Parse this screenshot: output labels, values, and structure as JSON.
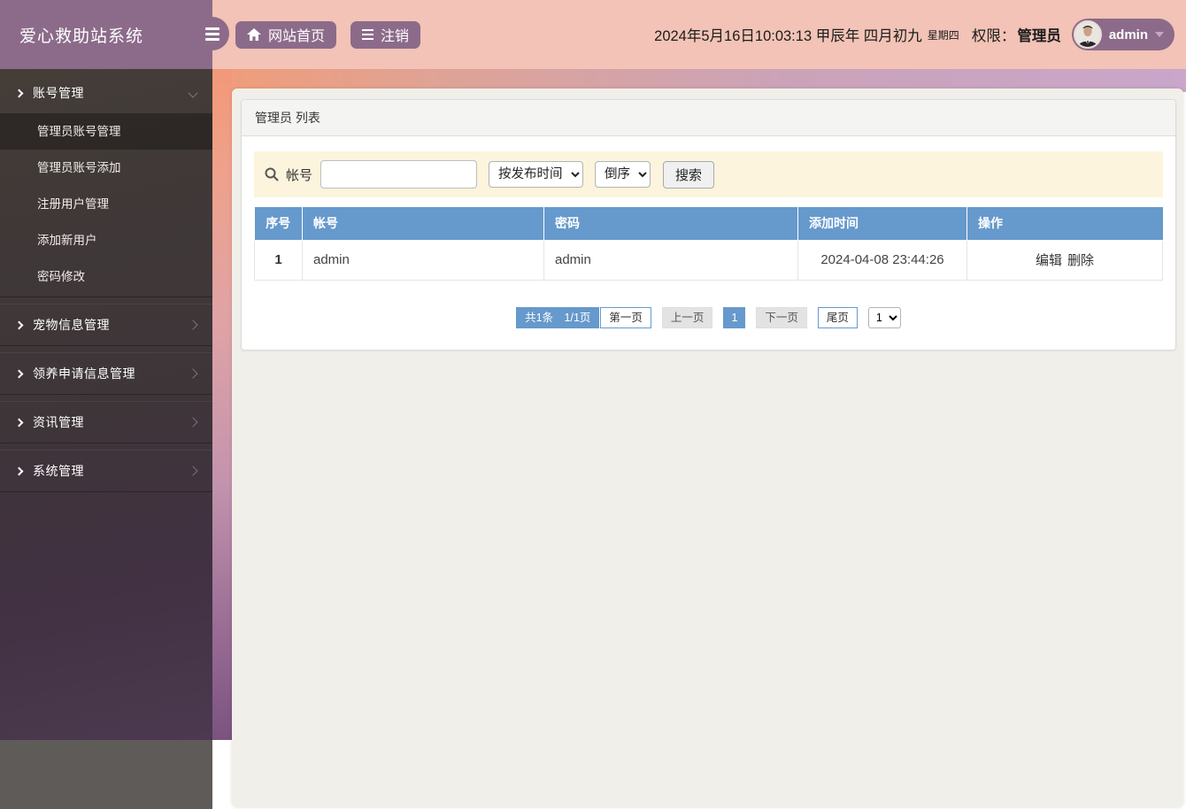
{
  "app": {
    "title": "爱心救助站系统"
  },
  "topbar": {
    "home_button": "网站首页",
    "logout_button": "注销",
    "datetime": "2024年5月16日10:03:13 甲辰年 四月初九",
    "weekday": "星期四",
    "permission_label": "权限：",
    "permission_value": "管理员",
    "username": "admin"
  },
  "sidebar": {
    "groups": [
      {
        "label": "账号管理",
        "expanded": true,
        "items": [
          "管理员账号管理",
          "管理员账号添加",
          "注册用户管理",
          "添加新用户",
          "密码修改"
        ],
        "active_item": "管理员账号管理"
      },
      {
        "label": "宠物信息管理",
        "expanded": false
      },
      {
        "label": "领养申请信息管理",
        "expanded": false
      },
      {
        "label": "资讯管理",
        "expanded": false
      },
      {
        "label": "系统管理",
        "expanded": false
      }
    ]
  },
  "panel": {
    "title": "管理员 列表",
    "search": {
      "field_label": "帐号",
      "input_value": "",
      "sort_field_selected": "按发布时间",
      "sort_order_selected": "倒序",
      "search_button": "搜索"
    },
    "table": {
      "headers": [
        "序号",
        "帐号",
        "密码",
        "添加时间",
        "操作"
      ],
      "rows": [
        {
          "index": "1",
          "account": "admin",
          "password": "admin",
          "added_time": "2024-04-08 23:44:26",
          "actions": [
            "编辑",
            "删除"
          ]
        }
      ]
    },
    "pagination": {
      "summary": "共1条　1/1页",
      "first": "第一页",
      "prev": "上一页",
      "current": "1",
      "next": "下一页",
      "last": "尾页",
      "page_select_value": "1"
    }
  },
  "icons": {
    "menu-icon": "≡",
    "home-icon": "⌂",
    "list-icon": "☰",
    "search-icon": "🔍",
    "chevron-right-icon": "›",
    "chevron-down-icon": "⌄",
    "caret-down-icon": "▾"
  },
  "colors": {
    "brand_purple": "#8c6b8a",
    "header_pink": "#f2c3b6",
    "table_header_blue": "#6699cc",
    "search_bar_bg": "#fcf4dc",
    "content_bg": "#f1efe9",
    "pagination_blue": "#6699cc"
  }
}
